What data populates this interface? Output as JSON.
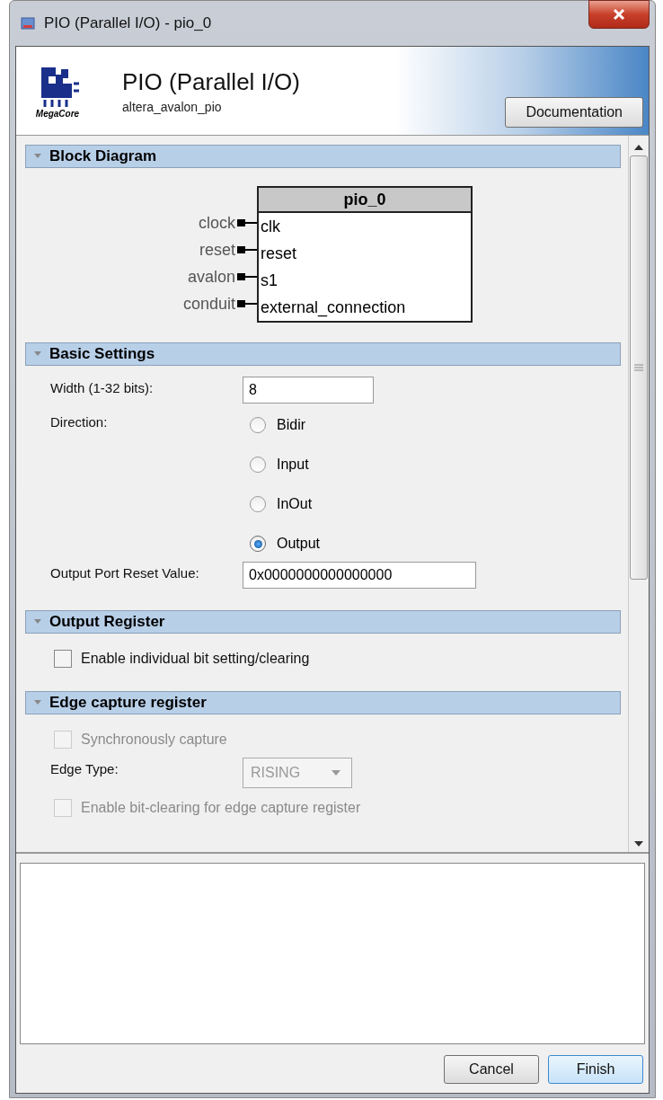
{
  "window": {
    "title": "PIO (Parallel I/O) - pio_0"
  },
  "header": {
    "logo_text": "MegaCore",
    "title": "PIO (Parallel I/O)",
    "subtitle": "altera_avalon_pio",
    "documentation_button": "Documentation"
  },
  "sections": [
    {
      "title": "Block Diagram",
      "expanded": true,
      "rows": [
        {
          "kind": "diagram",
          "block_name": "pio_0",
          "ports": [
            {
              "interface": "clock",
              "port": "clk"
            },
            {
              "interface": "reset",
              "port": "reset"
            },
            {
              "interface": "avalon",
              "port": "s1"
            },
            {
              "interface": "conduit",
              "port": "external_connection"
            }
          ]
        }
      ]
    },
    {
      "title": "Basic Settings",
      "expanded": true,
      "rows": [
        {
          "kind": "text_field",
          "label": "Width (1-32 bits):",
          "value": "8",
          "wide": false
        },
        {
          "kind": "radio_group",
          "label": "Direction:",
          "options": [
            {
              "label": "Bidir",
              "selected": false
            },
            {
              "label": "Input",
              "selected": false
            },
            {
              "label": "InOut",
              "selected": false
            },
            {
              "label": "Output",
              "selected": true
            }
          ]
        },
        {
          "kind": "text_field",
          "label": "Output Port Reset Value:",
          "value": "0x0000000000000000",
          "wide": true
        }
      ]
    },
    {
      "title": "Output Register",
      "expanded": true,
      "rows": [
        {
          "kind": "checkbox",
          "label": "Enable individual bit setting/clearing",
          "checked": false,
          "disabled": false
        }
      ]
    },
    {
      "title": "Edge capture register",
      "expanded": true,
      "rows": [
        {
          "kind": "checkbox",
          "label": "Synchronously capture",
          "checked": false,
          "disabled": true
        },
        {
          "kind": "dropdown",
          "label": "Edge Type:",
          "value": "RISING",
          "disabled": true
        },
        {
          "kind": "checkbox",
          "label": "Enable bit-clearing for edge capture register",
          "checked": false,
          "disabled": true
        }
      ]
    }
  ],
  "buttons": [
    {
      "label": "Cancel",
      "default": false
    },
    {
      "label": "Finish",
      "default": true
    }
  ]
}
